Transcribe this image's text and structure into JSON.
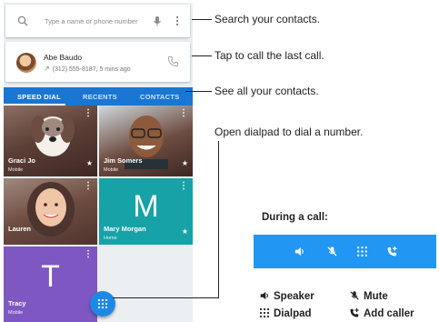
{
  "search": {
    "placeholder": "Type a name or phone number"
  },
  "last_call": {
    "name": "Abe Baudo",
    "details": "(312) 555-8187, 5 mins ago"
  },
  "tabs": [
    {
      "label": "SPEED DIAL"
    },
    {
      "label": "RECENTS"
    },
    {
      "label": "CONTACTS"
    }
  ],
  "speed_dial": [
    {
      "name": "Graci Jo",
      "type": "Mobile"
    },
    {
      "name": "Jim Somers",
      "type": "Mobile"
    },
    {
      "name": "Lauren",
      "type": ""
    },
    {
      "name": "Mary Morgan",
      "type": "Home",
      "initial": "M"
    },
    {
      "name": "Tracy",
      "type": "Mobile",
      "initial": "T"
    }
  ],
  "callouts": {
    "search": "Search your contacts.",
    "last_call": "Tap to call the last call.",
    "contacts": "See all your contacts.",
    "dialpad": "Open dialpad to dial a number."
  },
  "in_call": {
    "title": "During a call:",
    "speaker": "Speaker",
    "mute": "Mute",
    "dialpad": "Dialpad",
    "add_caller": "Add caller"
  },
  "colors": {
    "accent": "#1976d2",
    "bar": "#2196f3",
    "teal_tile": "#17a2a7",
    "purple_tile": "#7e57c2",
    "missed_arrow": "#43a047"
  }
}
